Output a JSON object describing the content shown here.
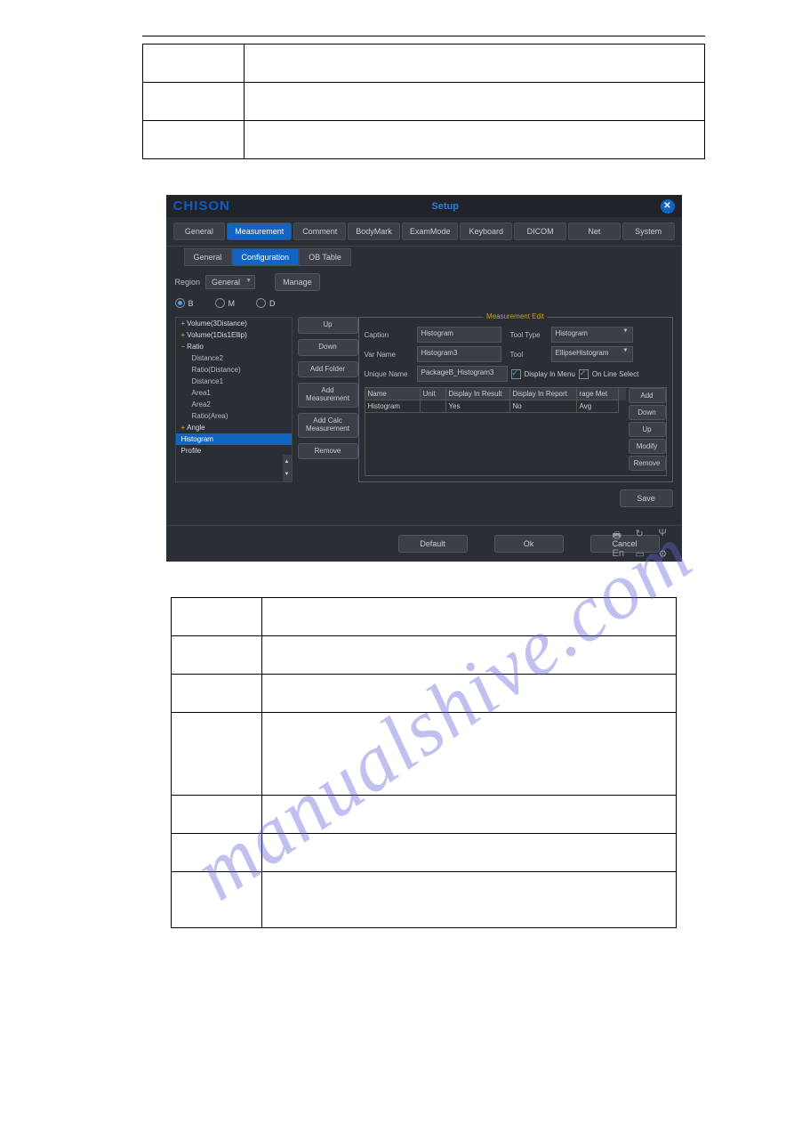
{
  "brand": "CHISON",
  "window_title": "Setup",
  "maintabs": [
    "General",
    "Measurement",
    "Comment",
    "BodyMark",
    "ExamMode",
    "Keyboard",
    "DICOM",
    "Net",
    "System"
  ],
  "subtabs": [
    "General",
    "Configuration",
    "OB Table"
  ],
  "region_label": "Region",
  "region_value": "General",
  "manage_label": "Manage",
  "radios": [
    "B",
    "M",
    "D"
  ],
  "tree": [
    {
      "label": "Volume(3Distance)",
      "lvl": 1,
      "exp": "+"
    },
    {
      "label": "Volume(1Dis1Ellip)",
      "lvl": 1,
      "exp": "+"
    },
    {
      "label": "Ratio",
      "lvl": 1,
      "exp": "−"
    },
    {
      "label": "Distance2",
      "lvl": 2
    },
    {
      "label": "Ratio(Distance)",
      "lvl": 2
    },
    {
      "label": "Distance1",
      "lvl": 2
    },
    {
      "label": "Area1",
      "lvl": 2
    },
    {
      "label": "Area2",
      "lvl": 2
    },
    {
      "label": "Ratio(Area)",
      "lvl": 2
    },
    {
      "label": "Angle",
      "lvl": 1,
      "exp": "+"
    },
    {
      "label": "Histogram",
      "lvl": 1,
      "selected": true
    },
    {
      "label": "Profile",
      "lvl": 1
    }
  ],
  "side_buttons": [
    "Up",
    "Down",
    "Add Folder",
    "Add Measurement",
    "Add Calc Measurement",
    "Remove"
  ],
  "edit_title": "Measurement Edit",
  "form": {
    "caption_label": "Caption",
    "caption_value": "Histogram",
    "tooltype_label": "Tool Type",
    "tooltype_value": "Histogram",
    "varname_label": "Var Name",
    "varname_value": "Histogram3",
    "tool_label": "Tool",
    "tool_value": "EllipseHistogram",
    "uniquename_label": "Unique Name",
    "uniquename_value": "PackageB_Histogram3",
    "display_menu_label": "Display In Menu",
    "online_select_label": "On Line Select"
  },
  "mini_table": {
    "headers": [
      "Name",
      "Unit",
      "Display In Result",
      "Display In Report",
      "rage Met"
    ],
    "row": [
      "Histogram",
      "",
      "Yes",
      "No",
      "Avg"
    ],
    "buttons": [
      "Add",
      "Down",
      "Up",
      "Modify",
      "Remove"
    ]
  },
  "save_label": "Save",
  "footer_buttons": [
    "Default",
    "Ok",
    "Cancel"
  ],
  "footer_lang": "En",
  "watermark": "manualshive.com"
}
